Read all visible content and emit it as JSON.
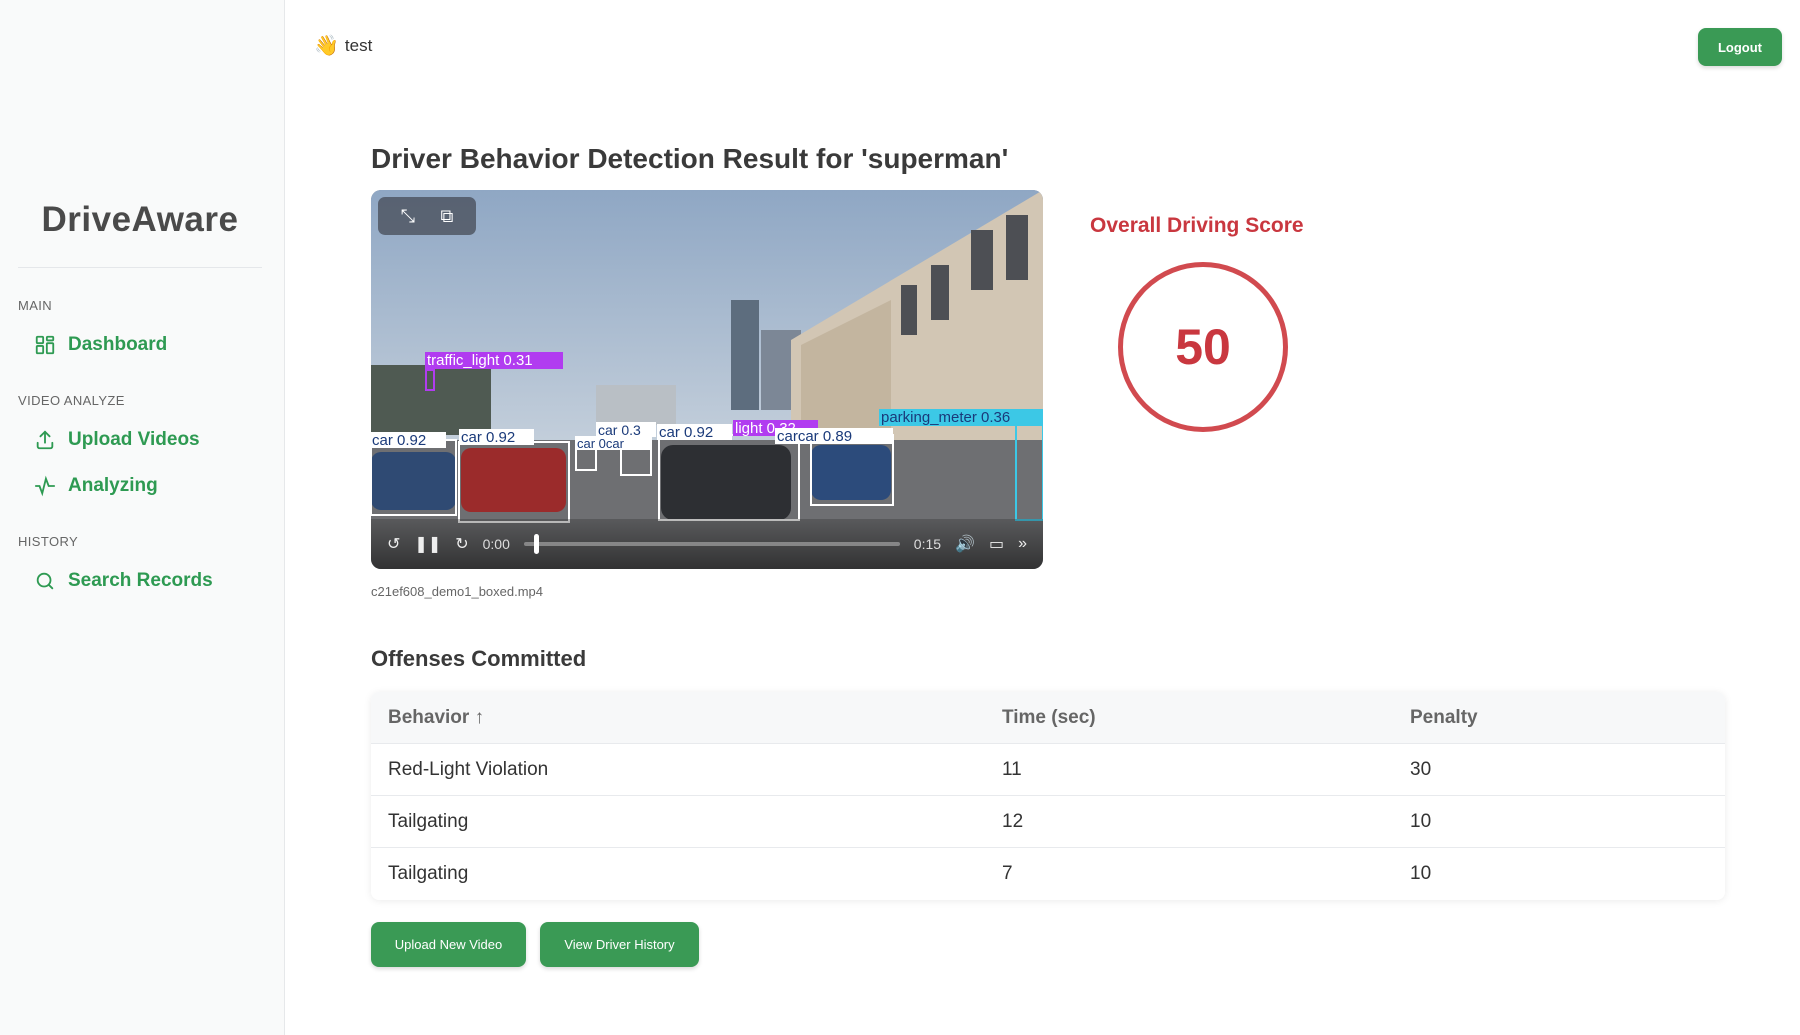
{
  "user": {
    "emoji": "👋",
    "name": "test"
  },
  "logout_label": "Logout",
  "brand": "DriveAware",
  "nav": {
    "main_label": "MAIN",
    "dashboard": "Dashboard",
    "video_label": "VIDEO ANALYZE",
    "upload": "Upload Videos",
    "analyzing": "Analyzing",
    "history_label": "HISTORY",
    "search": "Search Records"
  },
  "page_title": "Driver Behavior Detection Result for 'superman'",
  "video": {
    "current_time": "0:00",
    "duration": "0:15",
    "progress": 0.0,
    "filename": "c21ef608_demo1_boxed.mp4",
    "detections": {
      "traffic_light_1": "traffic_light 0.31",
      "parking_meter": "parking_meter 0.36",
      "car_a": "car 0.92",
      "car_b": "car 0.92",
      "car_c": "car 0.3",
      "car_d": "car 0car",
      "car_e": "car 0.92",
      "light_2": "light 0.32",
      "car_f": "carcar 0.89"
    },
    "colors": {
      "traffic_light": "#b13cf0",
      "parking_meter": "#3cc8e6",
      "car": "#ffffff"
    }
  },
  "score": {
    "title": "Overall Driving Score",
    "value": "50",
    "color": "#c9373f"
  },
  "offenses": {
    "title": "Offenses Committed",
    "headers": {
      "behavior": "Behavior ↑",
      "time": "Time (sec)",
      "penalty": "Penalty"
    },
    "rows": [
      {
        "behavior": "Red-Light Violation",
        "time": "11",
        "penalty": "30"
      },
      {
        "behavior": "Tailgating",
        "time": "12",
        "penalty": "10"
      },
      {
        "behavior": "Tailgating",
        "time": "7",
        "penalty": "10"
      }
    ]
  },
  "buttons": {
    "upload_new": "Upload New Video",
    "view_history": "View Driver History"
  },
  "colors": {
    "accent": "#3a9a55",
    "nav_text": "#2e9a52"
  }
}
